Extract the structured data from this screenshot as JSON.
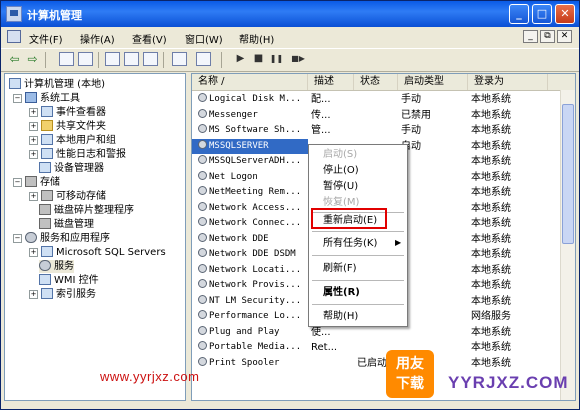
{
  "window": {
    "title": "计算机管理",
    "min": "_",
    "max": "□",
    "close": "✕"
  },
  "menu": {
    "items": [
      "文件(F)",
      "操作(A)",
      "查看(V)",
      "窗口(W)",
      "帮助(H)"
    ],
    "mdi": [
      "_",
      "⧉",
      "✕"
    ]
  },
  "toolbar": {
    "back": "⇦",
    "forward": "⇨",
    "play": "▶",
    "stop": "■",
    "pause": "❚❚",
    "restart": "■▶"
  },
  "tree": {
    "root": "计算机管理 (本地)",
    "system_tools": "系统工具",
    "event_viewer": "事件查看器",
    "shared_folders": "共享文件夹",
    "local_users": "本地用户和组",
    "perf_logs": "性能日志和警报",
    "device_manager": "设备管理器",
    "storage": "存储",
    "removable": "可移动存储",
    "defrag": "磁盘碎片整理程序",
    "disk_mgmt": "磁盘管理",
    "services_apps": "服务和应用程序",
    "sql_servers": "Microsoft SQL Servers",
    "services": "服务",
    "wmi": "WMI 控件",
    "index": "索引服务"
  },
  "list": {
    "columns": [
      "名称  /",
      "描述",
      "状态",
      "启动类型",
      "登录为"
    ],
    "rows": [
      {
        "name": "Logical Disk M...",
        "desc": "配...",
        "status": "",
        "startup": "手动",
        "logon": "本地系统"
      },
      {
        "name": "Messenger",
        "desc": "传...",
        "status": "",
        "startup": "已禁用",
        "logon": "本地系统"
      },
      {
        "name": "MS Software Sh...",
        "desc": "管...",
        "status": "",
        "startup": "手动",
        "logon": "本地系统"
      },
      {
        "name": "MSSQLSERVER",
        "desc": "",
        "status": "",
        "startup": "自动",
        "logon": "本地系统"
      },
      {
        "name": "MSSQLServerADH...",
        "desc": "",
        "status": "",
        "startup": "",
        "logon": "本地系统"
      },
      {
        "name": "Net Logon",
        "desc": "",
        "status": "",
        "startup": "",
        "logon": "本地系统"
      },
      {
        "name": "NetMeeting Rem...",
        "desc": "",
        "status": "",
        "startup": "",
        "logon": "本地系统"
      },
      {
        "name": "Network Access...",
        "desc": "",
        "status": "",
        "startup": "",
        "logon": "本地系统"
      },
      {
        "name": "Network Connec...",
        "desc": "",
        "status": "",
        "startup": "",
        "logon": "本地系统"
      },
      {
        "name": "Network DDE",
        "desc": "",
        "status": "",
        "startup": "",
        "logon": "本地系统"
      },
      {
        "name": "Network DDE DSDM",
        "desc": "",
        "status": "",
        "startup": "",
        "logon": "本地系统"
      },
      {
        "name": "Network Locati...",
        "desc": "",
        "status": "",
        "startup": "",
        "logon": "本地系统"
      },
      {
        "name": "Network Provis...",
        "desc": "",
        "status": "",
        "startup": "",
        "logon": "本地系统"
      },
      {
        "name": "NT LM Security...",
        "desc": "",
        "status": "",
        "startup": "",
        "logon": "本地系统"
      },
      {
        "name": "Performance Lo...",
        "desc": "",
        "status": "",
        "startup": "",
        "logon": "网络服务"
      },
      {
        "name": "Plug and Play",
        "desc": "使...",
        "status": "",
        "startup": "",
        "logon": "本地系统"
      },
      {
        "name": "Portable Media...",
        "desc": "Ret...",
        "status": "",
        "startup": "",
        "logon": "本地系统"
      },
      {
        "name": "Print Spooler",
        "desc": "",
        "status": "已启动",
        "startup": "",
        "logon": "本地系统"
      }
    ]
  },
  "context_menu": {
    "start": "启动(S)",
    "stop": "停止(O)",
    "pause": "暂停(U)",
    "resume": "恢复(M)",
    "restart": "重新启动(E)",
    "all_tasks": "所有任务(K)",
    "submenu_arrow": "▶",
    "refresh": "刷新(F)",
    "properties": "属性(R)",
    "help": "帮助(H)"
  },
  "watermark": {
    "url": "www.yyrjxz.com",
    "badge": "用友\n下载",
    "site": "YYRJXZ.COM"
  }
}
